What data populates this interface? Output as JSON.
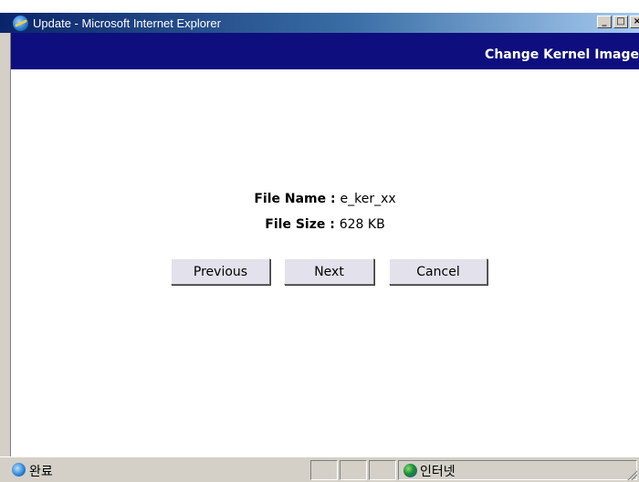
{
  "window": {
    "title": "Update - Microsoft Internet Explorer",
    "controls": {
      "minimize": "_",
      "maximize": "□",
      "close": "×"
    }
  },
  "header": {
    "title": "Change Kernel Image"
  },
  "file": {
    "name_label": "File Name",
    "name_value": "e_ker_xx",
    "size_label": "File Size",
    "size_value": "628 KB",
    "separator": " : "
  },
  "buttons": {
    "previous": "Previous",
    "next": "Next",
    "cancel": "Cancel"
  },
  "status": {
    "text": "완료",
    "zone": "인터넷"
  },
  "colors": {
    "header_band": "#0e0e7e",
    "button_face": "#e3e1ec",
    "window_chrome": "#d4d0c8"
  }
}
